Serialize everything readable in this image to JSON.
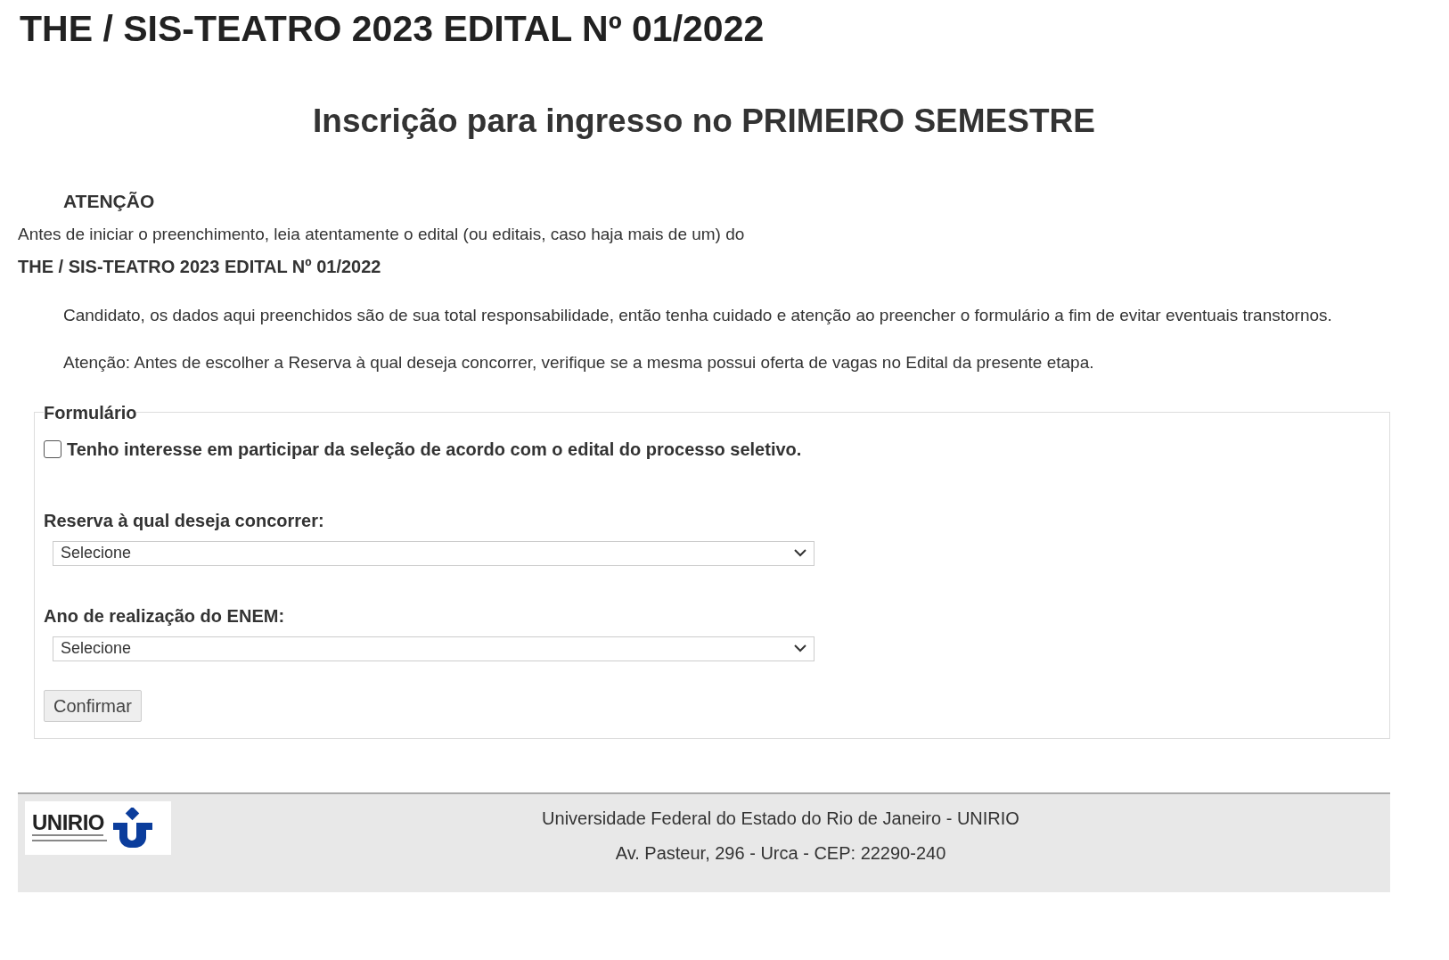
{
  "page_title": "THE / SIS-TEATRO 2023 EDITAL Nº 01/2022",
  "subtitle": "Inscrição para ingresso no PRIMEIRO SEMESTRE",
  "notice": {
    "heading": "ATENÇÃO",
    "intro": "Antes de iniciar o preenchimento, leia atentamente o edital (ou editais, caso haja mais de um) do",
    "edital": "THE / SIS-TEATRO 2023 EDITAL Nº 01/2022",
    "paragraphs": [
      "Candidato, os dados aqui preenchidos são de sua total responsabilidade, então tenha cuidado e atenção ao preencher o formulário a fim de evitar eventuais transtornos.",
      "Atenção: Antes de escolher a Reserva à qual deseja concorrer, verifique se a mesma possui oferta de vagas no Edital da presente etapa."
    ]
  },
  "form": {
    "legend": "Formulário",
    "agree": {
      "label": "Tenho interesse em participar da seleção de acordo com o edital do processo seletivo.",
      "checked": false
    },
    "selects": [
      {
        "label": "Reserva à qual deseja concorrer:",
        "value": "Selecione"
      },
      {
        "label": "Ano de realização do ENEM:",
        "value": "Selecione"
      }
    ],
    "submit": "Confirmar"
  },
  "footer": {
    "logo_text": "UNIRIO",
    "lines": [
      "Universidade Federal do Estado do Rio de Janeiro - UNIRIO",
      "Av. Pasteur, 296 - Urca - CEP: 22290-240"
    ]
  }
}
